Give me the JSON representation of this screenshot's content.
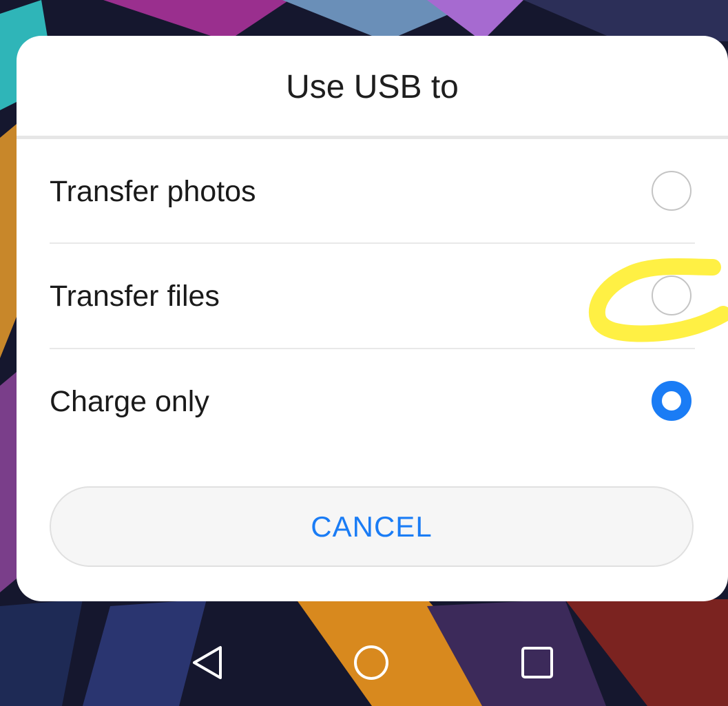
{
  "dialog": {
    "title": "Use USB to",
    "options": [
      {
        "label": "Transfer photos",
        "selected": false
      },
      {
        "label": "Transfer files",
        "selected": false
      },
      {
        "label": "Charge only",
        "selected": true
      }
    ],
    "cancel_label": "CANCEL"
  },
  "navbar": {
    "buttons": [
      "back-icon",
      "home-icon",
      "recents-icon"
    ]
  },
  "colors": {
    "accent": "#1a7cf5",
    "highlight": "#ffef3a",
    "dialog_bg": "#ffffff",
    "wallpaper_base": "#15172e"
  }
}
